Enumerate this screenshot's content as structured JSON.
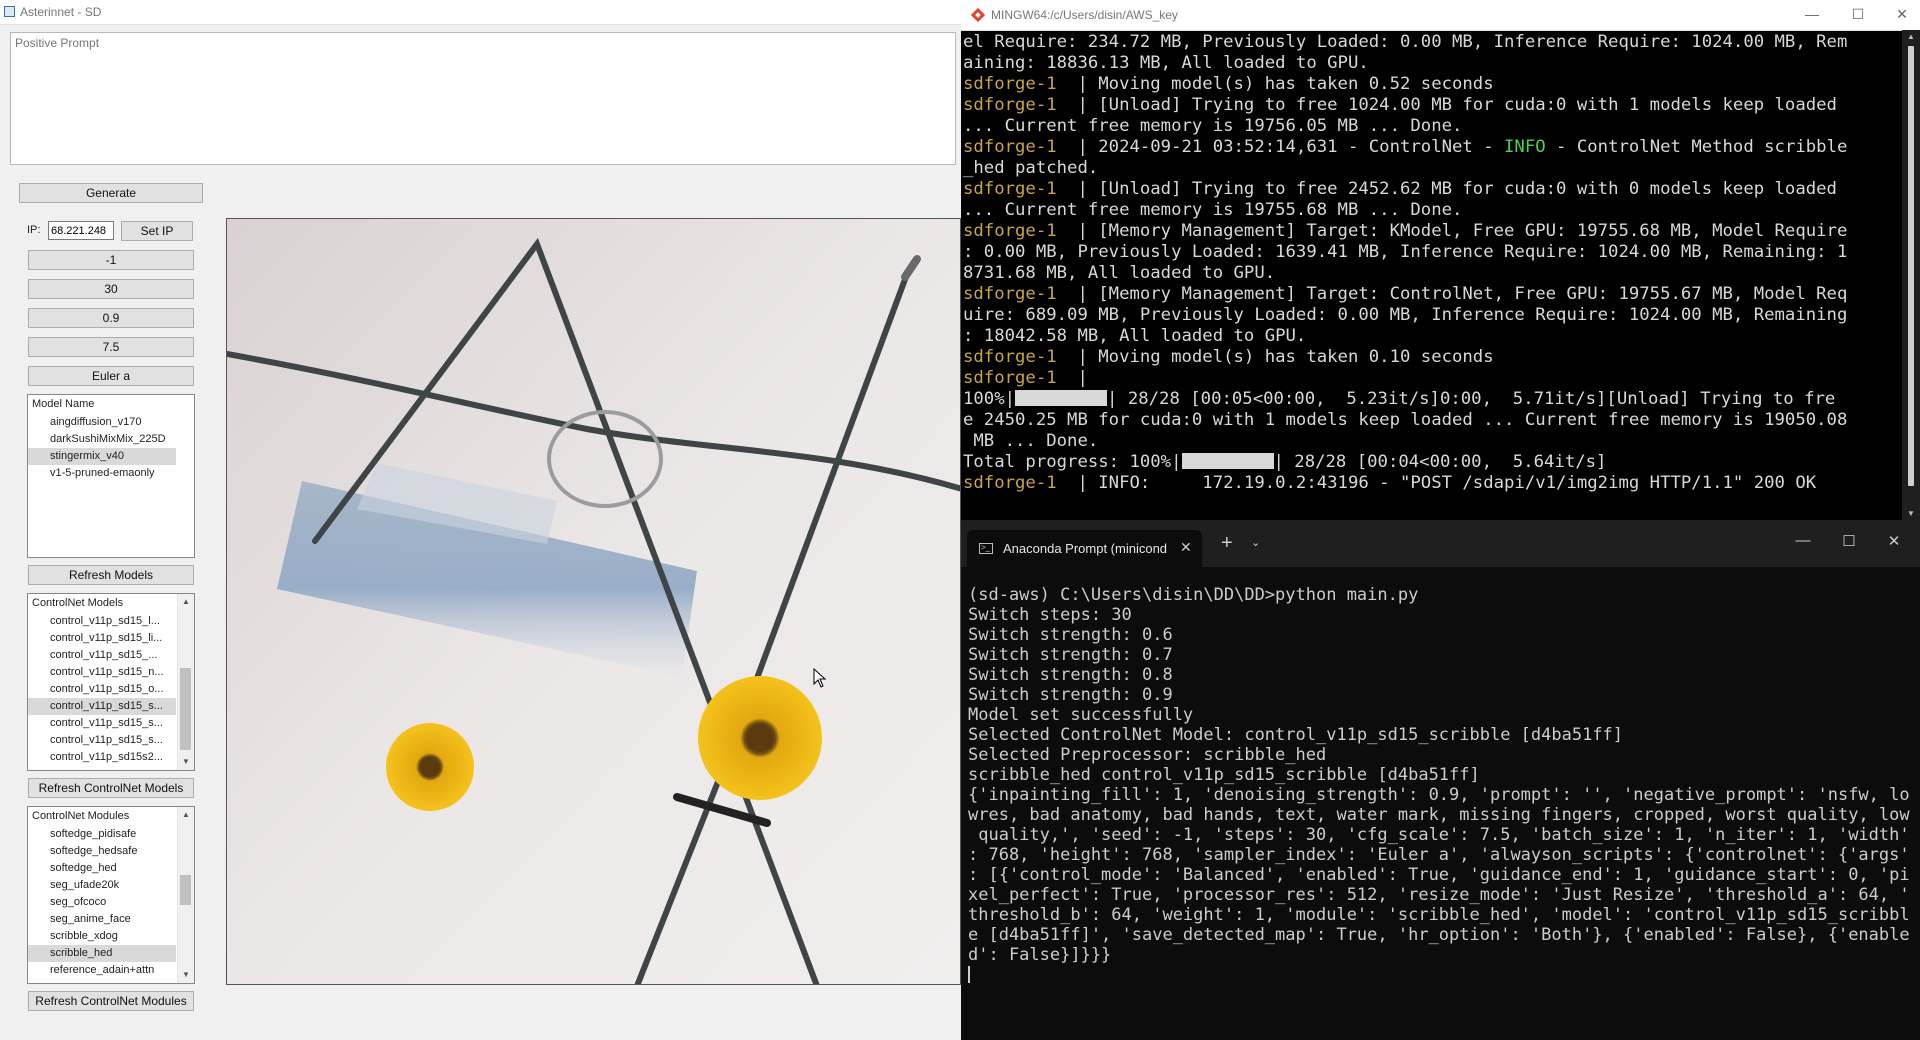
{
  "app": {
    "title": "Asterinnet - SD",
    "prompt_placeholder": "Positive Prompt",
    "generate_label": "Generate",
    "ip_label": "IP:",
    "ip_value": "68.221.248",
    "set_ip_label": "Set IP",
    "seed": "-1",
    "steps": "30",
    "strength": "0.9",
    "cfg": "7.5",
    "sampler": "Euler a",
    "model_list": {
      "header": "Model Name",
      "items": [
        "aingdiffusion_v170",
        "darkSushiMixMix_225D",
        "stingermix_v40",
        "v1-5-pruned-emaonly"
      ],
      "selected": 2
    },
    "refresh_models_label": "Refresh Models",
    "controlnet_models": {
      "header": "ControlNet Models",
      "items": [
        "control_v11p_sd15_l...",
        "control_v11p_sd15_li...",
        "control_v11p_sd15_...",
        "control_v11p_sd15_n...",
        "control_v11p_sd15_o...",
        "control_v11p_sd15_s...",
        "control_v11p_sd15_s...",
        "control_v11p_sd15_s...",
        "control_v11p_sd15s2..."
      ],
      "selected": 5
    },
    "refresh_controlnet_models_label": "Refresh ControlNet Models",
    "controlnet_modules": {
      "header": "ControlNet Modules",
      "items": [
        "softedge_pidisafe",
        "softedge_hedsafe",
        "softedge_hed",
        "seg_ufade20k",
        "seg_ofcoco",
        "seg_anime_face",
        "scribble_xdog",
        "scribble_hed",
        "reference_adain+attn"
      ],
      "selected": 7
    },
    "refresh_controlnet_modules_label": "Refresh ControlNet Modules"
  },
  "bash": {
    "title": "MINGW64:/c/Users/disin/AWS_key",
    "prefix": "sdforge-1",
    "lines": [
      [
        [
          "",
          "el Require: 234.72 MB, Previously Loaded: 0.00 MB, Inference Require: 1024.00 MB, Rem"
        ]
      ],
      [
        [
          "",
          "aining: 18836.13 MB, All loaded to GPU."
        ]
      ],
      [
        [
          "y",
          "sdforge-1"
        ],
        [
          "",
          "  | Moving model(s) has taken 0.52 seconds"
        ]
      ],
      [
        [
          "y",
          "sdforge-1"
        ],
        [
          "",
          "  | [Unload] Trying to free 1024.00 MB for cuda:0 with 1 models keep loaded"
        ]
      ],
      [
        [
          "",
          "... Current free memory is 19756.05 MB ... Done."
        ]
      ],
      [
        [
          "y",
          "sdforge-1"
        ],
        [
          "",
          "  | 2024-09-21 03:52:14,631 - ControlNet - "
        ],
        [
          "g",
          "INFO"
        ],
        [
          "",
          " - ControlNet Method scribble"
        ]
      ],
      [
        [
          "",
          "_hed patched."
        ]
      ],
      [
        [
          "y",
          "sdforge-1"
        ],
        [
          "",
          "  | [Unload] Trying to free 2452.62 MB for cuda:0 with 0 models keep loaded"
        ]
      ],
      [
        [
          "",
          "... Current free memory is 19755.68 MB ... Done."
        ]
      ],
      [
        [
          "y",
          "sdforge-1"
        ],
        [
          "",
          "  | [Memory Management] Target: KModel, Free GPU: 19755.68 MB, Model Require"
        ]
      ],
      [
        [
          "",
          ": 0.00 MB, Previously Loaded: 1639.41 MB, Inference Require: 1024.00 MB, Remaining: 1"
        ]
      ],
      [
        [
          "",
          "8731.68 MB, All loaded to GPU."
        ]
      ],
      [
        [
          "y",
          "sdforge-1"
        ],
        [
          "",
          "  | [Memory Management] Target: ControlNet, Free GPU: 19755.67 MB, Model Req"
        ]
      ],
      [
        [
          "",
          "uire: 689.09 MB, Previously Loaded: 0.00 MB, Inference Require: 1024.00 MB, Remaining"
        ]
      ],
      [
        [
          "",
          ": 18042.58 MB, All loaded to GPU."
        ]
      ],
      [
        [
          "y",
          "sdforge-1"
        ],
        [
          "",
          "  | Moving model(s) has taken 0.10 seconds"
        ]
      ],
      [
        [
          "y",
          "sdforge-1"
        ],
        [
          "",
          "  |"
        ]
      ],
      [
        [
          "",
          "100%|"
        ],
        [
          "bar",
          ""
        ],
        [
          "",
          "| 28/28 [00:05<00:00,  5.23it/s]0:00,  5.71it/s][Unload] Trying to fre"
        ]
      ],
      [
        [
          "",
          "e 2450.25 MB for cuda:0 with 1 models keep loaded ... Current free memory is 19050.08"
        ]
      ],
      [
        [
          "",
          " MB ... Done."
        ]
      ],
      [
        [
          "",
          "Total progress: 100%|"
        ],
        [
          "bar",
          ""
        ],
        [
          "",
          "| 28/28 [00:04<00:00,  5.64it/s]"
        ]
      ],
      [
        [
          "y",
          "sdforge-1"
        ],
        [
          "",
          "  | INFO:     172.19.0.2:43196 - \"POST /sdapi/v1/img2img HTTP/1.1\" 200 OK"
        ]
      ]
    ]
  },
  "conda": {
    "tab_title": "Anaconda Prompt (minicond",
    "lines": [
      "(sd-aws) C:\\Users\\disin\\DD\\DD>python main.py",
      "Switch steps: 30",
      "Switch strength: 0.6",
      "Switch strength: 0.7",
      "Switch strength: 0.8",
      "Switch strength: 0.9",
      "Model set successfully",
      "Selected ControlNet Model: control_v11p_sd15_scribble [d4ba51ff]",
      "Selected Preprocessor: scribble_hed",
      "scribble_hed control_v11p_sd15_scribble [d4ba51ff]",
      "{'inpainting_fill': 1, 'denoising_strength': 0.9, 'prompt': '', 'negative_prompt': 'nsfw, lo",
      "wres, bad anatomy, bad hands, text, water mark, missing fingers, cropped, worst quality, low",
      " quality,', 'seed': -1, 'steps': 30, 'cfg_scale': 7.5, 'batch_size': 1, 'n_iter': 1, 'width'",
      ": 768, 'height': 768, 'sampler_index': 'Euler a', 'alwayson_scripts': {'controlnet': {'args'",
      ": [{'control_mode': 'Balanced', 'enabled': True, 'guidance_end': 1, 'guidance_start': 0, 'pi",
      "xel_perfect': True, 'processor_res': 512, 'resize_mode': 'Just Resize', 'threshold_a': 64, '",
      "threshold_b': 64, 'weight': 1, 'module': 'scribble_hed', 'model': 'control_v11p_sd15_scribbl",
      "e [d4ba51ff]', 'save_detected_map': True, 'hr_option': 'Both'}, {'enabled': False}, {'enable",
      "d': False}]}}}"
    ]
  },
  "colors": {
    "terminal_prefix": "#c8a645",
    "info_green": "#4ed34e"
  }
}
